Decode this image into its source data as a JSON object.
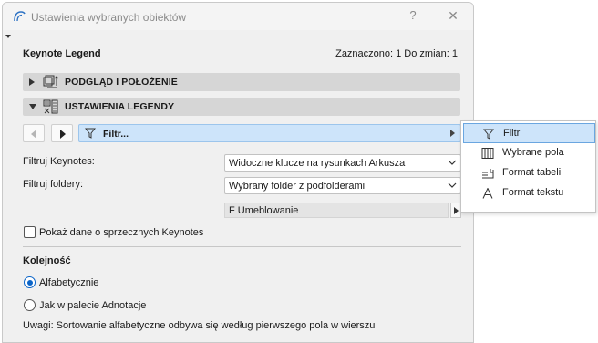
{
  "window": {
    "title": "Ustawienia wybranych obiektów",
    "help_label": "?",
    "close_label": "✕"
  },
  "header": {
    "object_type": "Keynote Legend",
    "status": "Zaznaczono: 1 Do zmian: 1"
  },
  "sections": {
    "preview": "PODGLĄD I POŁOŻENIE",
    "legend": "USTAWIENIA LEGENDY"
  },
  "panel_nav": {
    "current_panel": "Filtr..."
  },
  "filters": {
    "keynotes_label": "Filtruj Keynotes:",
    "keynotes_value": "Widoczne klucze na rysunkach Arkusza",
    "folders_label": "Filtruj foldery:",
    "folders_value": "Wybrany folder z podfolderami",
    "folder_path": "F Umeblowanie"
  },
  "options": {
    "show_conflict_label": "Pokaż dane o sprzecznych Keynotes",
    "show_conflict_checked": false
  },
  "sorting": {
    "title": "Kolejność",
    "alpha_label": "Alfabetycznie",
    "palette_label": "Jak w palecie Adnotacje",
    "selected": "alpha",
    "note": "Uwagi: Sortowanie alfabetyczne odbywa się według pierwszego pola w wierszu"
  },
  "popup_menu": {
    "items": [
      {
        "label": "Filtr",
        "icon": "funnel-icon",
        "selected": true
      },
      {
        "label": "Wybrane pola",
        "icon": "columns-icon",
        "selected": false
      },
      {
        "label": "Format tabeli",
        "icon": "table-format-icon",
        "selected": false
      },
      {
        "label": "Format tekstu",
        "icon": "text-format-icon",
        "selected": false
      }
    ]
  },
  "colors": {
    "accent": "#0a64c8",
    "selection_fill": "#cde4fa",
    "section_bar": "#d6d6d6"
  }
}
